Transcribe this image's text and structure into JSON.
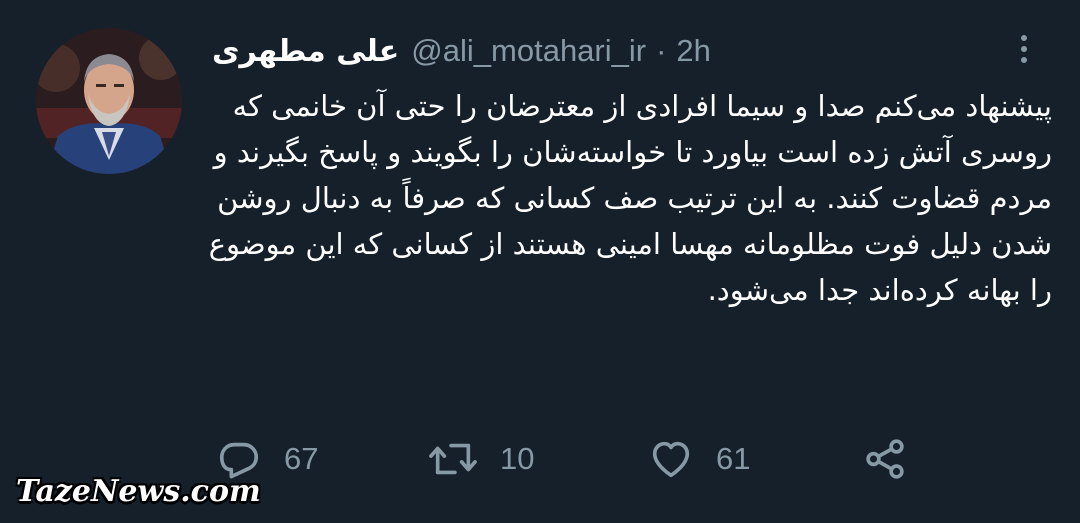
{
  "tweet": {
    "display_name": "علی مطهری",
    "handle": "@ali_motahari_ir",
    "separator": "·",
    "time": "2h",
    "text": "پیشنهاد می‌کنم صدا و سیما افرادی از معترضان را حتی آن خانمی که روسری آتش زده است بیاورد تا خواسته‌شان را بگویند و پاسخ بگیرند و مردم قضاوت کنند. به این ترتیب صف کسانی که صرفاً به دنبال روشن شدن دلیل فوت مظلومانه مهسا امینی هستند از کسانی که این موضوع را بهانه کرده‌اند جدا می‌شود."
  },
  "actions": {
    "replies": "67",
    "retweets": "10",
    "likes": "61"
  },
  "icons": {
    "reply": "reply-icon",
    "retweet": "retweet-icon",
    "like": "heart-icon",
    "share": "share-icon",
    "more": "more-vertical-icon"
  },
  "colors": {
    "background": "#15202b",
    "text": "#ffffff",
    "secondary": "#8899a6"
  },
  "watermark": "TazeNews.com"
}
